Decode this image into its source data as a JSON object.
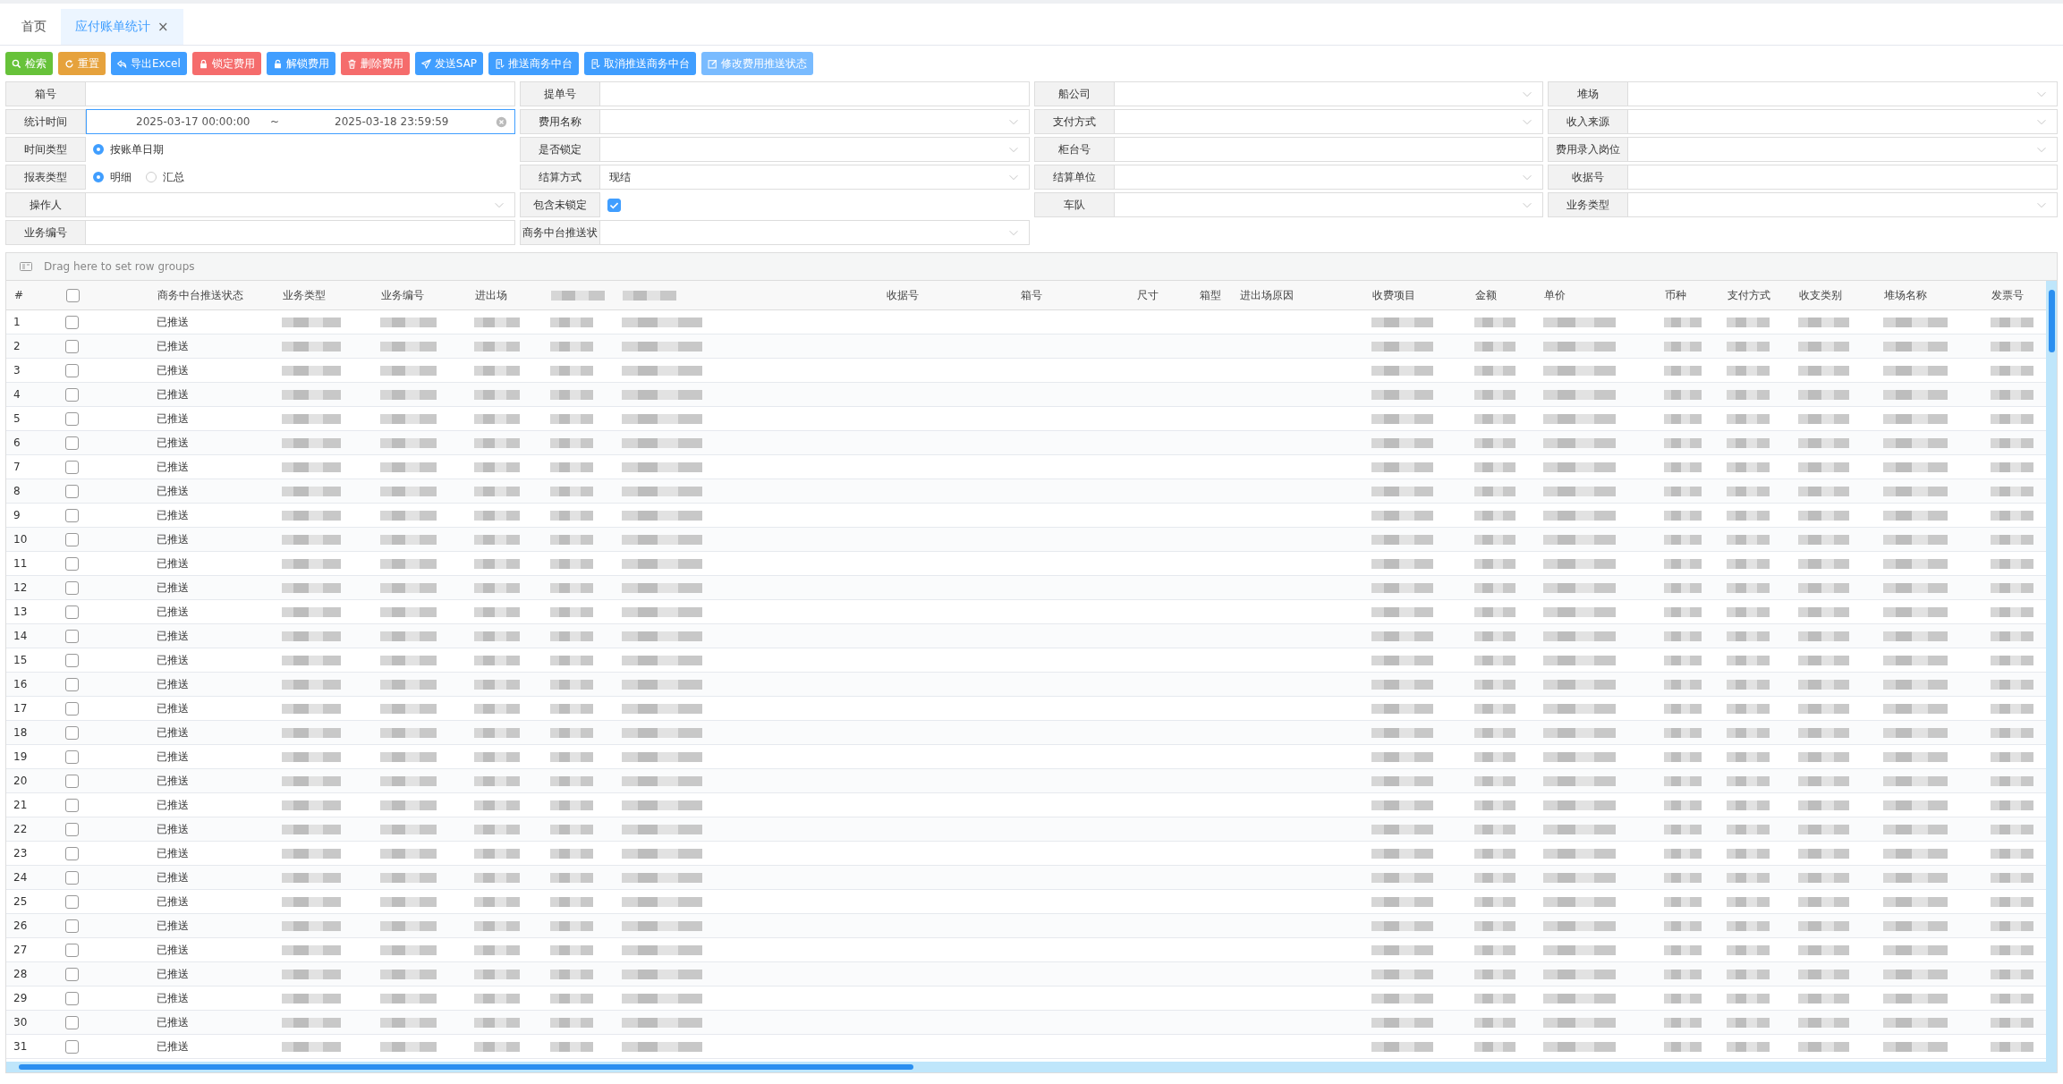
{
  "tabs": [
    {
      "label": "首页",
      "selected": false
    },
    {
      "label": "应付账单统计",
      "selected": true,
      "close": "×"
    }
  ],
  "toolbar": [
    {
      "label": "检索",
      "color": "#67c23a"
    },
    {
      "label": "重置",
      "color": "#e6a23c"
    },
    {
      "label": "导出Excel",
      "color": "#409eff"
    },
    {
      "label": "锁定费用",
      "color": "#f56c6c"
    },
    {
      "label": "解锁费用",
      "color": "#409eff"
    },
    {
      "label": "删除费用",
      "color": "#f56c6c"
    },
    {
      "label": "发送SAP",
      "color": "#409eff"
    },
    {
      "label": "推送商务中台",
      "color": "#409eff"
    },
    {
      "label": "取消推送商务中台",
      "color": "#409eff"
    },
    {
      "label": "修改费用推送状态",
      "color": "#79bbff"
    }
  ],
  "filters": [
    {
      "label": "箱号",
      "kind": "text"
    },
    {
      "label": "提单号",
      "kind": "text"
    },
    {
      "label": "船公司",
      "kind": "select"
    },
    {
      "label": "堆场",
      "kind": "select"
    },
    {
      "label": "统计时间",
      "kind": "daterange",
      "start": "2025-03-17 00:00:00",
      "separator": "~",
      "end": "2025-03-18 23:59:59"
    },
    {
      "label": "费用名称",
      "kind": "select"
    },
    {
      "label": "支付方式",
      "kind": "select"
    },
    {
      "label": "收入来源",
      "kind": "select"
    },
    {
      "label": "时间类型",
      "kind": "radio",
      "options": [
        {
          "label": "按账单日期",
          "selected": true
        }
      ]
    },
    {
      "label": "是否锁定",
      "kind": "select"
    },
    {
      "label": "柜台号",
      "kind": "text"
    },
    {
      "label": "费用录入岗位",
      "kind": "select"
    },
    {
      "label": "报表类型",
      "kind": "radio",
      "options": [
        {
          "label": "明细",
          "selected": true
        },
        {
          "label": "汇总",
          "selected": false
        }
      ]
    },
    {
      "label": "结算方式",
      "kind": "select",
      "value": "现结"
    },
    {
      "label": "结算单位",
      "kind": "select"
    },
    {
      "label": "收据号",
      "kind": "text"
    },
    {
      "label": "操作人",
      "kind": "select"
    },
    {
      "label": "包含未锁定",
      "kind": "checkbox",
      "checked": true
    },
    {
      "label": "车队",
      "kind": "select"
    },
    {
      "label": "业务类型",
      "kind": "select"
    },
    {
      "label": "业务编号",
      "kind": "text"
    },
    {
      "label": "商务中台推送状",
      "kind": "select"
    }
  ],
  "grid": {
    "group_hint": "Drag here to set row groups",
    "header_checked": false,
    "columns": [
      {
        "kind": "index",
        "label": "#"
      },
      {
        "kind": "check"
      },
      {
        "kind": "status",
        "label": "商务中台推送状态"
      },
      {
        "kind": "blurred",
        "label": "业务类型"
      },
      {
        "kind": "blurred",
        "label": "业务编号"
      },
      {
        "kind": "blurred",
        "label": "进出场"
      },
      {
        "kind": "blurred"
      },
      {
        "kind": "blurred"
      },
      {
        "kind": "plain"
      },
      {
        "kind": "plain",
        "label": "收据号"
      },
      {
        "kind": "plain",
        "label": "箱号"
      },
      {
        "kind": "plain",
        "label": "尺寸"
      },
      {
        "kind": "plain",
        "label": "箱型"
      },
      {
        "kind": "plain",
        "label": "进出场原因"
      },
      {
        "kind": "blurred",
        "label": "收费项目"
      },
      {
        "kind": "blurred",
        "label": "金额"
      },
      {
        "kind": "blurred",
        "label": "单价"
      },
      {
        "kind": "blurred",
        "label": "币种"
      },
      {
        "kind": "blurred",
        "label": "支付方式"
      },
      {
        "kind": "blurred",
        "label": "收支类别"
      },
      {
        "kind": "blurred",
        "label": "堆场名称"
      },
      {
        "kind": "blurred",
        "label": "发票号"
      }
    ],
    "rows": [
      {
        "index": "1",
        "checked": false,
        "status": "已推送"
      },
      {
        "index": "2",
        "checked": false,
        "status": "已推送"
      },
      {
        "index": "3",
        "checked": false,
        "status": "已推送"
      },
      {
        "index": "4",
        "checked": false,
        "status": "已推送"
      },
      {
        "index": "5",
        "checked": false,
        "status": "已推送"
      },
      {
        "index": "6",
        "checked": false,
        "status": "已推送"
      },
      {
        "index": "7",
        "checked": false,
        "status": "已推送"
      },
      {
        "index": "8",
        "checked": false,
        "status": "已推送"
      },
      {
        "index": "9",
        "checked": false,
        "status": "已推送"
      },
      {
        "index": "10",
        "checked": false,
        "status": "已推送"
      },
      {
        "index": "11",
        "checked": false,
        "status": "已推送"
      },
      {
        "index": "12",
        "checked": false,
        "status": "已推送"
      },
      {
        "index": "13",
        "checked": false,
        "status": "已推送"
      },
      {
        "index": "14",
        "checked": false,
        "status": "已推送"
      },
      {
        "index": "15",
        "checked": false,
        "status": "已推送"
      },
      {
        "index": "16",
        "checked": false,
        "status": "已推送"
      },
      {
        "index": "17",
        "checked": false,
        "status": "已推送"
      },
      {
        "index": "18",
        "checked": false,
        "status": "已推送"
      },
      {
        "index": "19",
        "checked": false,
        "status": "已推送"
      },
      {
        "index": "20",
        "checked": false,
        "status": "已推送"
      },
      {
        "index": "21",
        "checked": false,
        "status": "已推送"
      },
      {
        "index": "22",
        "checked": false,
        "status": "已推送"
      },
      {
        "index": "23",
        "checked": false,
        "status": "已推送"
      },
      {
        "index": "24",
        "checked": false,
        "status": "已推送"
      },
      {
        "index": "25",
        "checked": false,
        "status": "已推送"
      },
      {
        "index": "26",
        "checked": false,
        "status": "已推送"
      },
      {
        "index": "27",
        "checked": false,
        "status": "已推送"
      },
      {
        "index": "28",
        "checked": false,
        "status": "已推送"
      },
      {
        "index": "29",
        "checked": false,
        "status": "已推送"
      },
      {
        "index": "30",
        "checked": false,
        "status": "已推送"
      },
      {
        "index": "31",
        "checked": false,
        "status": "已推送"
      }
    ]
  }
}
